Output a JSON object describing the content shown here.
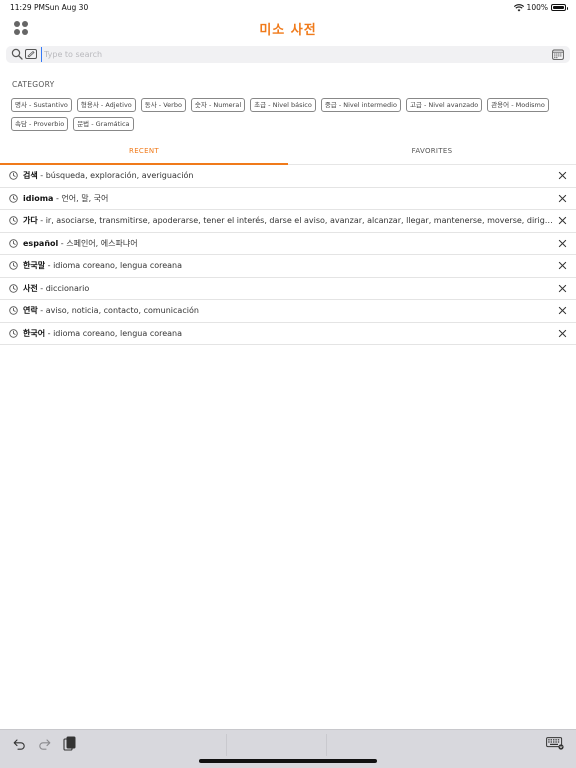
{
  "status": {
    "time": "11:29 PM",
    "date": "Sun Aug 30",
    "battery": "100%"
  },
  "header": {
    "title": "미소 사전",
    "accent_color": "#f07a1a"
  },
  "search": {
    "placeholder": "Type to search",
    "value": ""
  },
  "category": {
    "heading": "CATEGORY",
    "chips": [
      "명사 - Sustantivo",
      "형용사 - Adjetivo",
      "동사 - Verbo",
      "숫자 - Numeral",
      "초급 - Nivel básico",
      "중급 - Nivel intermedio",
      "고급 - Nivel avanzado",
      "관용어 - Modismo",
      "속담 - Proverbio",
      "문법 - Gramática"
    ]
  },
  "tabs": {
    "recent": "RECENT",
    "favorites": "FAVORITES",
    "active": "recent"
  },
  "recent": [
    {
      "word": "검색",
      "meaning": " - búsqueda, exploración, averiguación"
    },
    {
      "word": "idioma",
      "meaning": " - 언어, 말, 국어"
    },
    {
      "word": "가다",
      "meaning": " - ir, asociarse, transmitirse, apoderarse, tener el interés, darse el aviso, avanzar, alcanzar, llegar, mantenerse, moverse, dirigirse, irse, pasar"
    },
    {
      "word": "español",
      "meaning": " - 스페인어, 에스파냐어"
    },
    {
      "word": "한국말",
      "meaning": " - idioma coreano, lengua coreana"
    },
    {
      "word": "사전",
      "meaning": " - diccionario"
    },
    {
      "word": "연락",
      "meaning": " - aviso, noticia, contacto, comunicación"
    },
    {
      "word": "한국어",
      "meaning": " - idioma coreano, lengua coreana"
    }
  ],
  "icons": {
    "menu": "grid-icon",
    "search": "search-icon",
    "handwriting": "draw-icon",
    "calendar": "calendar-icon",
    "history": "clock-icon",
    "remove": "close-icon",
    "undo": "undo-icon",
    "redo": "redo-icon",
    "paste": "paste-icon",
    "keyboard": "keyboard-icon"
  }
}
